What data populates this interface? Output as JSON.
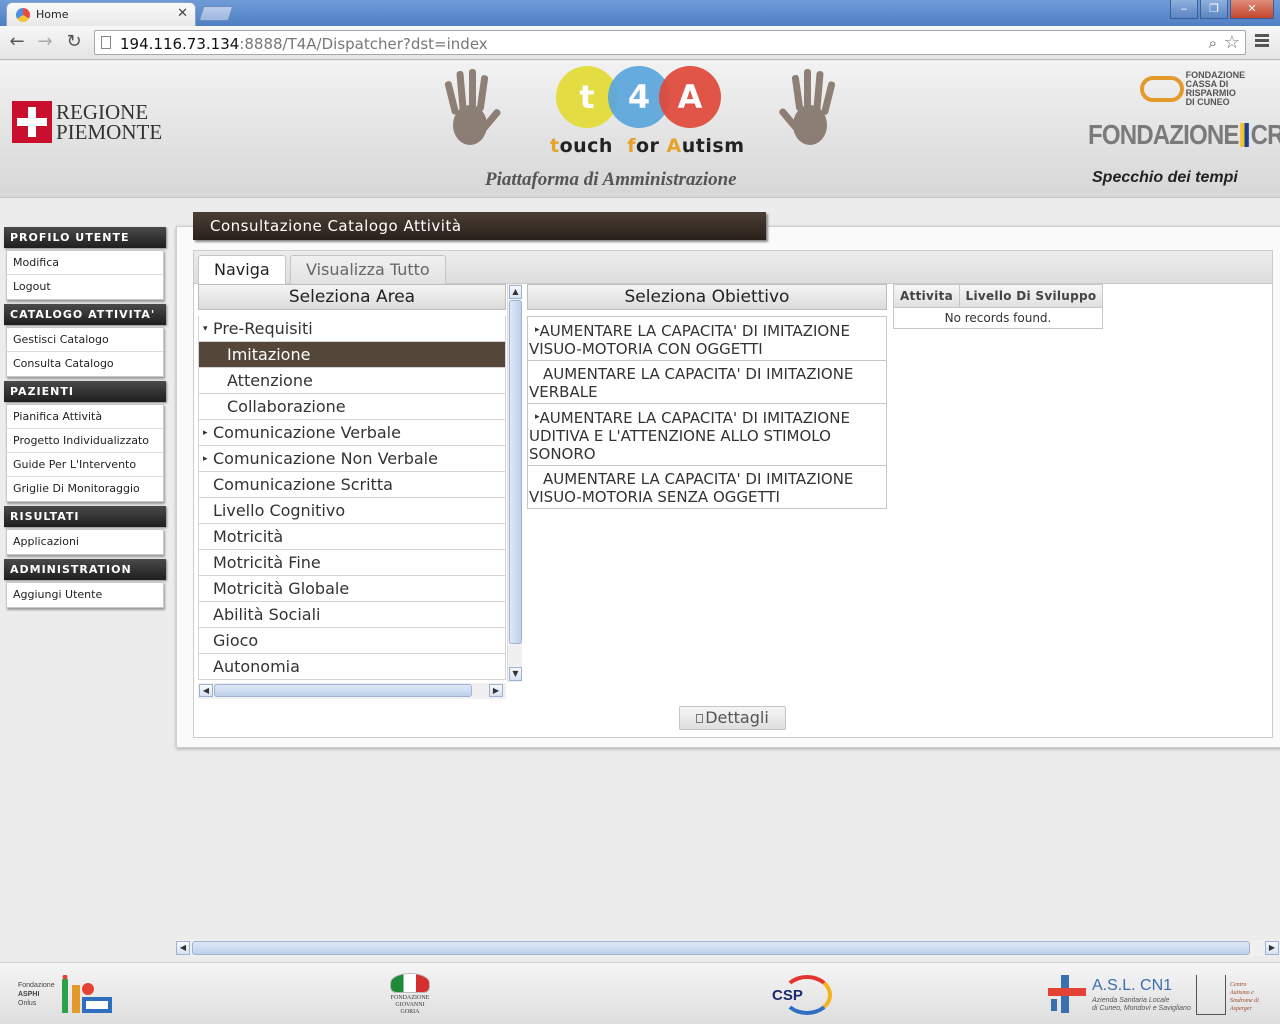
{
  "browser": {
    "tab_title": "Home",
    "tab_close": "✕",
    "url_host": "194.116.73.134",
    "url_rest": ":8888/T4A/Dispatcher?dst=index",
    "window_buttons": [
      "‒",
      "❐",
      "✕"
    ],
    "nav": {
      "back": "←",
      "forward": "→",
      "reload": "↻"
    }
  },
  "banner": {
    "regione_line1": "REGIONE",
    "regione_line2": "PIEMONTE",
    "t4a_letters": [
      "t",
      "4",
      "A"
    ],
    "tagline_t": "t",
    "tagline_ouch": "ouch",
    "tagline_f": "f",
    "tagline_or": "or",
    "tagline_a": "A",
    "tagline_utism": "utism",
    "platform_title": "Piattaforma di Amministrazione",
    "crc_line1": "FONDAZIONE",
    "crc_line2": "CASSA DI RISPARMIO",
    "crc_line3": "DI CUNEO",
    "crt_left": "FONDAZIONE",
    "crt_right": "CRT",
    "crt_tagline": "Specchio dei tempi"
  },
  "sidebar": {
    "sections": [
      {
        "title": "PROFILO UTENTE",
        "items": [
          "Modifica",
          "Logout"
        ]
      },
      {
        "title": "CATALOGO ATTIVITA'",
        "items": [
          "Gestisci Catalogo",
          "Consulta Catalogo"
        ]
      },
      {
        "title": "PAZIENTI",
        "items": [
          "Pianifica Attività",
          "Progetto Individualizzato",
          "Guide Per L'Intervento",
          "Griglie Di Monitoraggio"
        ]
      },
      {
        "title": "RISULTATI",
        "items": [
          "Applicazioni"
        ]
      },
      {
        "title": "ADMINISTRATION",
        "items": [
          "Aggiungi Utente"
        ]
      }
    ]
  },
  "main": {
    "page_title": "Consultazione Catalogo Attività",
    "tabs": [
      {
        "label": "Naviga",
        "active": true
      },
      {
        "label": "Visualizza Tutto",
        "active": false
      }
    ],
    "area": {
      "header": "Seleziona Area",
      "rows": [
        {
          "label": "Pre-Requisiti",
          "arrow": "▾",
          "child": false,
          "selected": false
        },
        {
          "label": "Imitazione",
          "arrow": "",
          "child": true,
          "selected": true
        },
        {
          "label": "Attenzione",
          "arrow": "",
          "child": true,
          "selected": false
        },
        {
          "label": "Collaborazione",
          "arrow": "",
          "child": true,
          "selected": false
        },
        {
          "label": "Comunicazione Verbale",
          "arrow": "▸",
          "child": false,
          "selected": false
        },
        {
          "label": "Comunicazione Non Verbale",
          "arrow": "▸",
          "child": false,
          "selected": false
        },
        {
          "label": "Comunicazione Scritta",
          "arrow": "",
          "child": false,
          "selected": false
        },
        {
          "label": "Livello Cognitivo",
          "arrow": "",
          "child": false,
          "selected": false
        },
        {
          "label": "Motricità",
          "arrow": "",
          "child": false,
          "selected": false
        },
        {
          "label": "Motricità Fine",
          "arrow": "",
          "child": false,
          "selected": false
        },
        {
          "label": "Motricità Globale",
          "arrow": "",
          "child": false,
          "selected": false
        },
        {
          "label": "Abilità Sociali",
          "arrow": "",
          "child": false,
          "selected": false
        },
        {
          "label": "Gioco",
          "arrow": "",
          "child": false,
          "selected": false
        },
        {
          "label": "Autonomia",
          "arrow": "",
          "child": false,
          "selected": false
        }
      ]
    },
    "objective": {
      "header": "Seleziona Obiettivo",
      "rows": [
        {
          "label": "AUMENTARE LA CAPACITA' DI IMITAZIONE VISUO-MOTORIA CON OGGETTI",
          "expandable": true
        },
        {
          "label": "AUMENTARE LA CAPACITA' DI IMITAZIONE VERBALE",
          "expandable": false
        },
        {
          "label": "AUMENTARE LA CAPACITA' DI IMITAZIONE UDITIVA E L'ATTENZIONE ALLO STIMOLO SONORO",
          "expandable": true
        },
        {
          "label": "AUMENTARE LA CAPACITA' DI IMITAZIONE VISUO-MOTORIA SENZA OGGETTI",
          "expandable": false
        }
      ]
    },
    "grid": {
      "columns": [
        "Attivita",
        "Livello Di Sviluppo"
      ],
      "empty_message": "No records found."
    },
    "details_button": "Dettagli"
  },
  "footer": {
    "asphi_line1": "Fondazione",
    "asphi_line2": "ASPHI",
    "asphi_line3": "Onlus",
    "goria_line1": "FONDAZIONE",
    "goria_line2": "GIOVANNI GORIA",
    "csp": "CSP",
    "asl_title": "A.S.L. CN1",
    "asl_sub1": "Azienda Sanitaria Locale",
    "asl_sub2": "di Cuneo, Mondovì e Savigliano",
    "centro_line1": "Centro",
    "centro_line2": "Autismo e",
    "centro_line3": "Sindrome di",
    "centro_line4": "Asperger"
  },
  "colors": {
    "selected_row": "#54473a",
    "title_bar": "#2a211b",
    "sidebar_header": "#1f1f1f"
  }
}
